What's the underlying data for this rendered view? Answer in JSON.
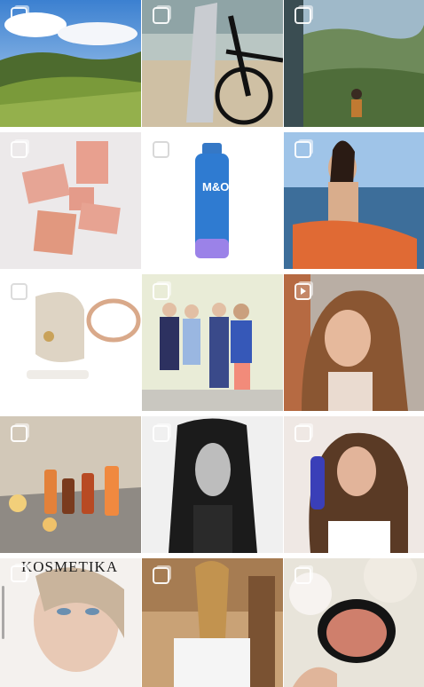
{
  "posts": [
    {
      "id": "p1",
      "kind": "landscape-vineyard"
    },
    {
      "id": "p2",
      "kind": "bike-towel"
    },
    {
      "id": "p3",
      "kind": "hiker-valley"
    },
    {
      "id": "p4",
      "kind": "soap-bars"
    },
    {
      "id": "p5",
      "kind": "spray-bottle",
      "label": "M&O"
    },
    {
      "id": "p6",
      "kind": "woman-sea"
    },
    {
      "id": "p7",
      "kind": "hair-tie"
    },
    {
      "id": "p8",
      "kind": "group-photo"
    },
    {
      "id": "p9",
      "kind": "portrait-reel"
    },
    {
      "id": "p10",
      "kind": "skincare-bottles"
    },
    {
      "id": "p11",
      "kind": "bw-model"
    },
    {
      "id": "p12",
      "kind": "model-product"
    },
    {
      "id": "p13",
      "kind": "magazine-cover",
      "title": "KOSMETIKA"
    },
    {
      "id": "p14",
      "kind": "braid-back"
    },
    {
      "id": "p15",
      "kind": "blush-compact"
    }
  ]
}
